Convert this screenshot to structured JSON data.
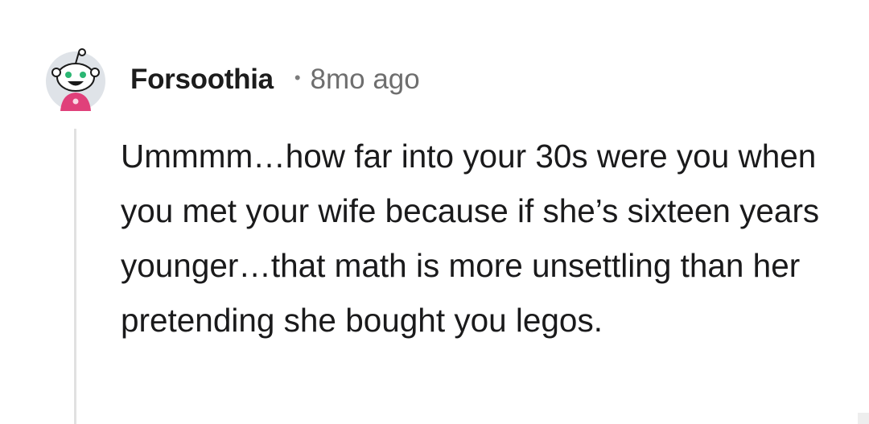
{
  "comment": {
    "author": "Forsoothia",
    "separator": "•",
    "timestamp": "8mo ago",
    "avatar_icon": "snoo-avatar-icon",
    "body": "Ummmm…how far into your 30s were you when you met your wife because if she’s sixteen years younger…that math is more unsettling than her pretending she bought you legos."
  },
  "colors": {
    "background": "#ffffff",
    "text": "#1a1a1b",
    "meta": "#6e6e6e",
    "thread_line": "#e1e1e1",
    "avatar_bg": "#dfe3e8",
    "avatar_shirt": "#e0407a"
  }
}
